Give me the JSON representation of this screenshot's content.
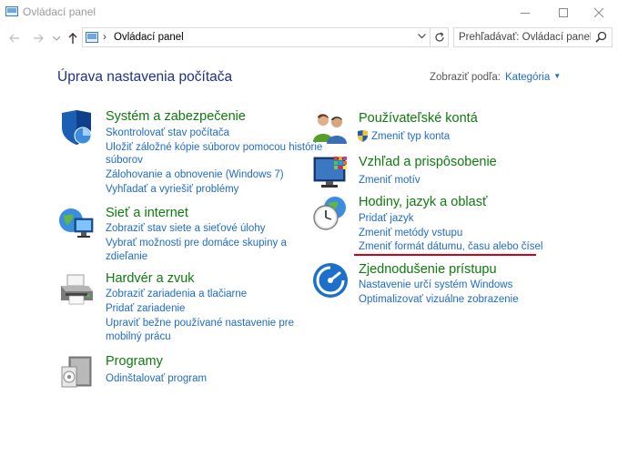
{
  "window": {
    "title": "Ovládací panel"
  },
  "address": {
    "path": "Ovládací panel",
    "search_placeholder": "Prehľadávať: Ovládací panel"
  },
  "header": {
    "page_title": "Úprava nastavenia počítača",
    "view_by_label": "Zobraziť podľa:",
    "view_by_value": "Kategória"
  },
  "categories": [
    {
      "title": "Systém a zabezpečenie",
      "links": [
        "Skontrolovať stav počítača",
        "Uložiť záložné kópie súborov pomocou histórie",
        "súborov",
        "Zálohovanie a obnovenie (Windows 7)",
        "Vyhľadať a vyriešiť problémy"
      ]
    },
    {
      "title": "Sieť a internet",
      "links": [
        "Zobraziť stav siete a sieťové úlohy",
        "Vybrať možnosti pre domáce skupiny a",
        "zdieľanie"
      ]
    },
    {
      "title": "Hardvér a zvuk",
      "links": [
        "Zobraziť zariadenia a tlačiarne",
        "Pridať zariadenie",
        "Upraviť bežne používané nastavenie pre",
        "mobilný prácu"
      ]
    },
    {
      "title": "Programy",
      "links": [
        "Odinštalovať program"
      ]
    },
    {
      "title": "Používateľské kontá",
      "links": [
        "Zmeniť typ konta"
      ]
    },
    {
      "title": "Vzhľad a prispôsobenie",
      "links": [
        "Zmeniť motív"
      ]
    },
    {
      "title": "Hodiny, jazyk a oblasť",
      "links": [
        "Pridať jazyk",
        "Zmeniť metódy vstupu",
        "Zmeniť formát dátumu, času alebo čísel"
      ]
    },
    {
      "title": "Zjednodušenie prístupu",
      "links": [
        "Nastavenie určí systém Windows",
        "Optimalizovať vizuálne zobrazenie"
      ]
    }
  ],
  "colors": {
    "title_blue": "#1e3287",
    "category_green": "#0e7a0e",
    "link_blue": "#1e6bc5",
    "annotation_red": "#d0021b"
  }
}
